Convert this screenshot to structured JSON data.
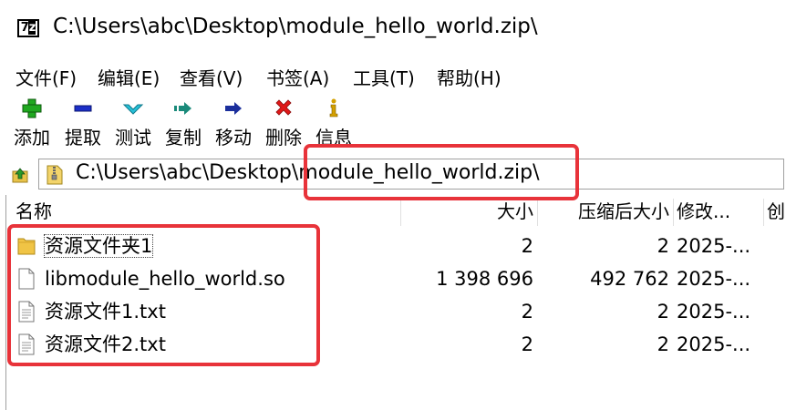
{
  "window": {
    "title": "C:\\Users\\abc\\Desktop\\module_hello_world.zip\\",
    "app_icon": {
      "prefix": "7",
      "suffix": "z"
    }
  },
  "menu": [
    {
      "label": "文件(F)"
    },
    {
      "label": "编辑(E)"
    },
    {
      "label": "查看(V)"
    },
    {
      "label": "书签(A)"
    },
    {
      "label": "工具(T)"
    },
    {
      "label": "帮助(H)"
    }
  ],
  "toolbar": [
    {
      "label": "添加",
      "icon": "plus-icon",
      "color": "#1fa81f"
    },
    {
      "label": "提取",
      "icon": "minus-icon",
      "color": "#1c2fc8"
    },
    {
      "label": "测试",
      "icon": "check-icon",
      "color": "#27c0d8"
    },
    {
      "label": "复制",
      "icon": "copy-arrow-icon",
      "color": "#1a8a7a"
    },
    {
      "label": "移动",
      "icon": "move-arrow-icon",
      "color": "#1b2f9c"
    },
    {
      "label": "删除",
      "icon": "delete-x-icon",
      "color": "#e01818"
    },
    {
      "label": "信息",
      "icon": "info-icon",
      "color": "#d4a000"
    }
  ],
  "address": {
    "path_prefix": "C:\\Users\\abc\\Desktop",
    "path_highlight": "\\module_hello_world.zip\\"
  },
  "columns": {
    "name": "名称",
    "size": "大小",
    "packed": "压缩后大小",
    "modified": "修改...",
    "created": "创"
  },
  "rows": [
    {
      "icon": "folder-icon",
      "name": "资源文件夹1",
      "size": "2",
      "packed": "2",
      "modified": "2025-..."
    },
    {
      "icon": "file-icon",
      "name": "libmodule_hello_world.so",
      "size": "1 398 696",
      "packed": "492 762",
      "modified": "2025-..."
    },
    {
      "icon": "text-file-icon",
      "name": "资源文件1.txt",
      "size": "2",
      "packed": "2",
      "modified": "2025-..."
    },
    {
      "icon": "text-file-icon",
      "name": "资源文件2.txt",
      "size": "2",
      "packed": "2",
      "modified": "2025-..."
    }
  ],
  "annotation_color": "#e8333a"
}
